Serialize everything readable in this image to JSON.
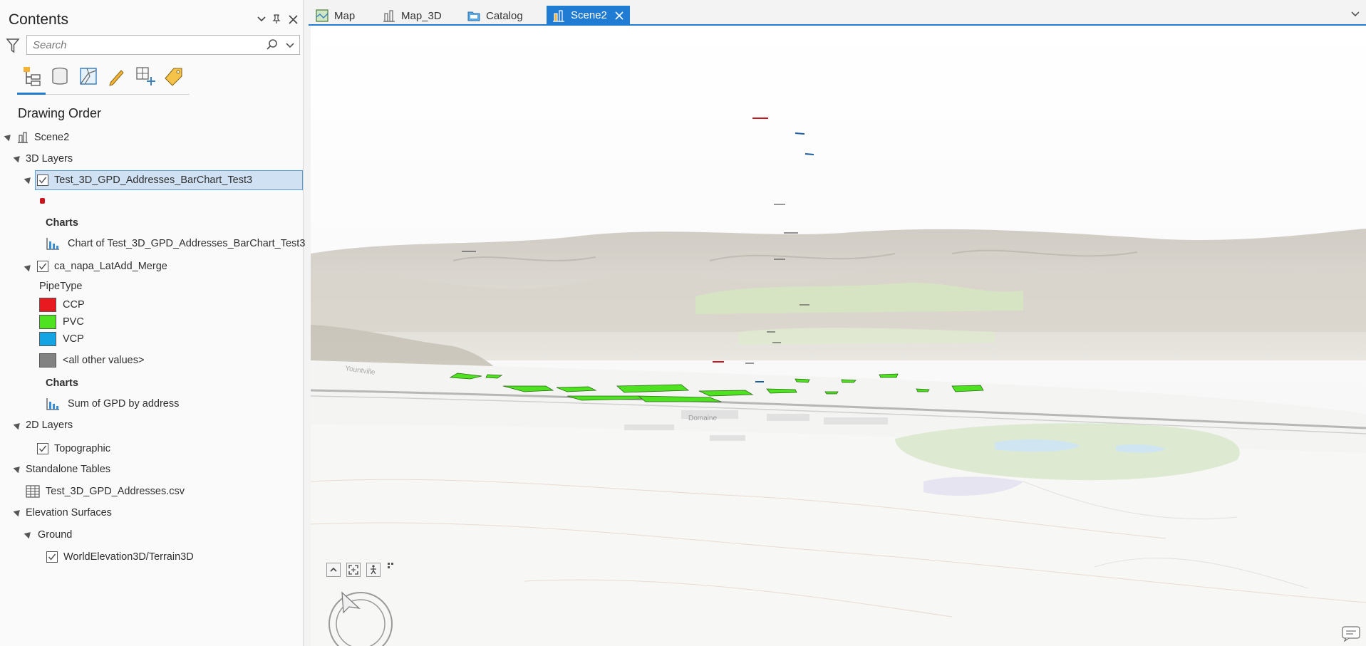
{
  "contents": {
    "title": "Contents",
    "search_placeholder": "Search",
    "section_title": "Drawing Order",
    "tree": {
      "scene": "Scene2",
      "layers_3d": "3D Layers",
      "layer1": "Test_3D_GPD_Addresses_BarChart_Test3",
      "layer1_charts": "Charts",
      "layer1_chart": "Chart of Test_3D_GPD_Addresses_BarChart_Test3",
      "layer2": "ca_napa_LatAdd_Merge",
      "field": "PipeType",
      "legend": [
        {
          "label": "CCP",
          "color": "#e8191f"
        },
        {
          "label": "PVC",
          "color": "#4ee221"
        },
        {
          "label": "VCP",
          "color": "#14a3e3"
        },
        {
          "label": "<all other values>",
          "color": "#828282"
        }
      ],
      "layer2_charts": "Charts",
      "layer2_chart": "Sum of GPD by address",
      "layers_2d": "2D Layers",
      "topographic": "Topographic",
      "standalone": "Standalone Tables",
      "table": "Test_3D_GPD_Addresses.csv",
      "elevation": "Elevation Surfaces",
      "ground": "Ground",
      "terrain": "WorldElevation3D/Terrain3D"
    }
  },
  "tabs": [
    {
      "label": "Map",
      "icon": "map-icon"
    },
    {
      "label": "Map_3D",
      "icon": "scene-icon"
    },
    {
      "label": "Catalog",
      "icon": "catalog-icon"
    },
    {
      "label": "Scene2",
      "icon": "scene-icon",
      "active": true
    }
  ],
  "scene": {
    "labels": {
      "place1": "Domaine",
      "place2": "Yountville"
    }
  },
  "colors": {
    "accent": "#1f7cd2",
    "pvc": "#4ee221"
  }
}
